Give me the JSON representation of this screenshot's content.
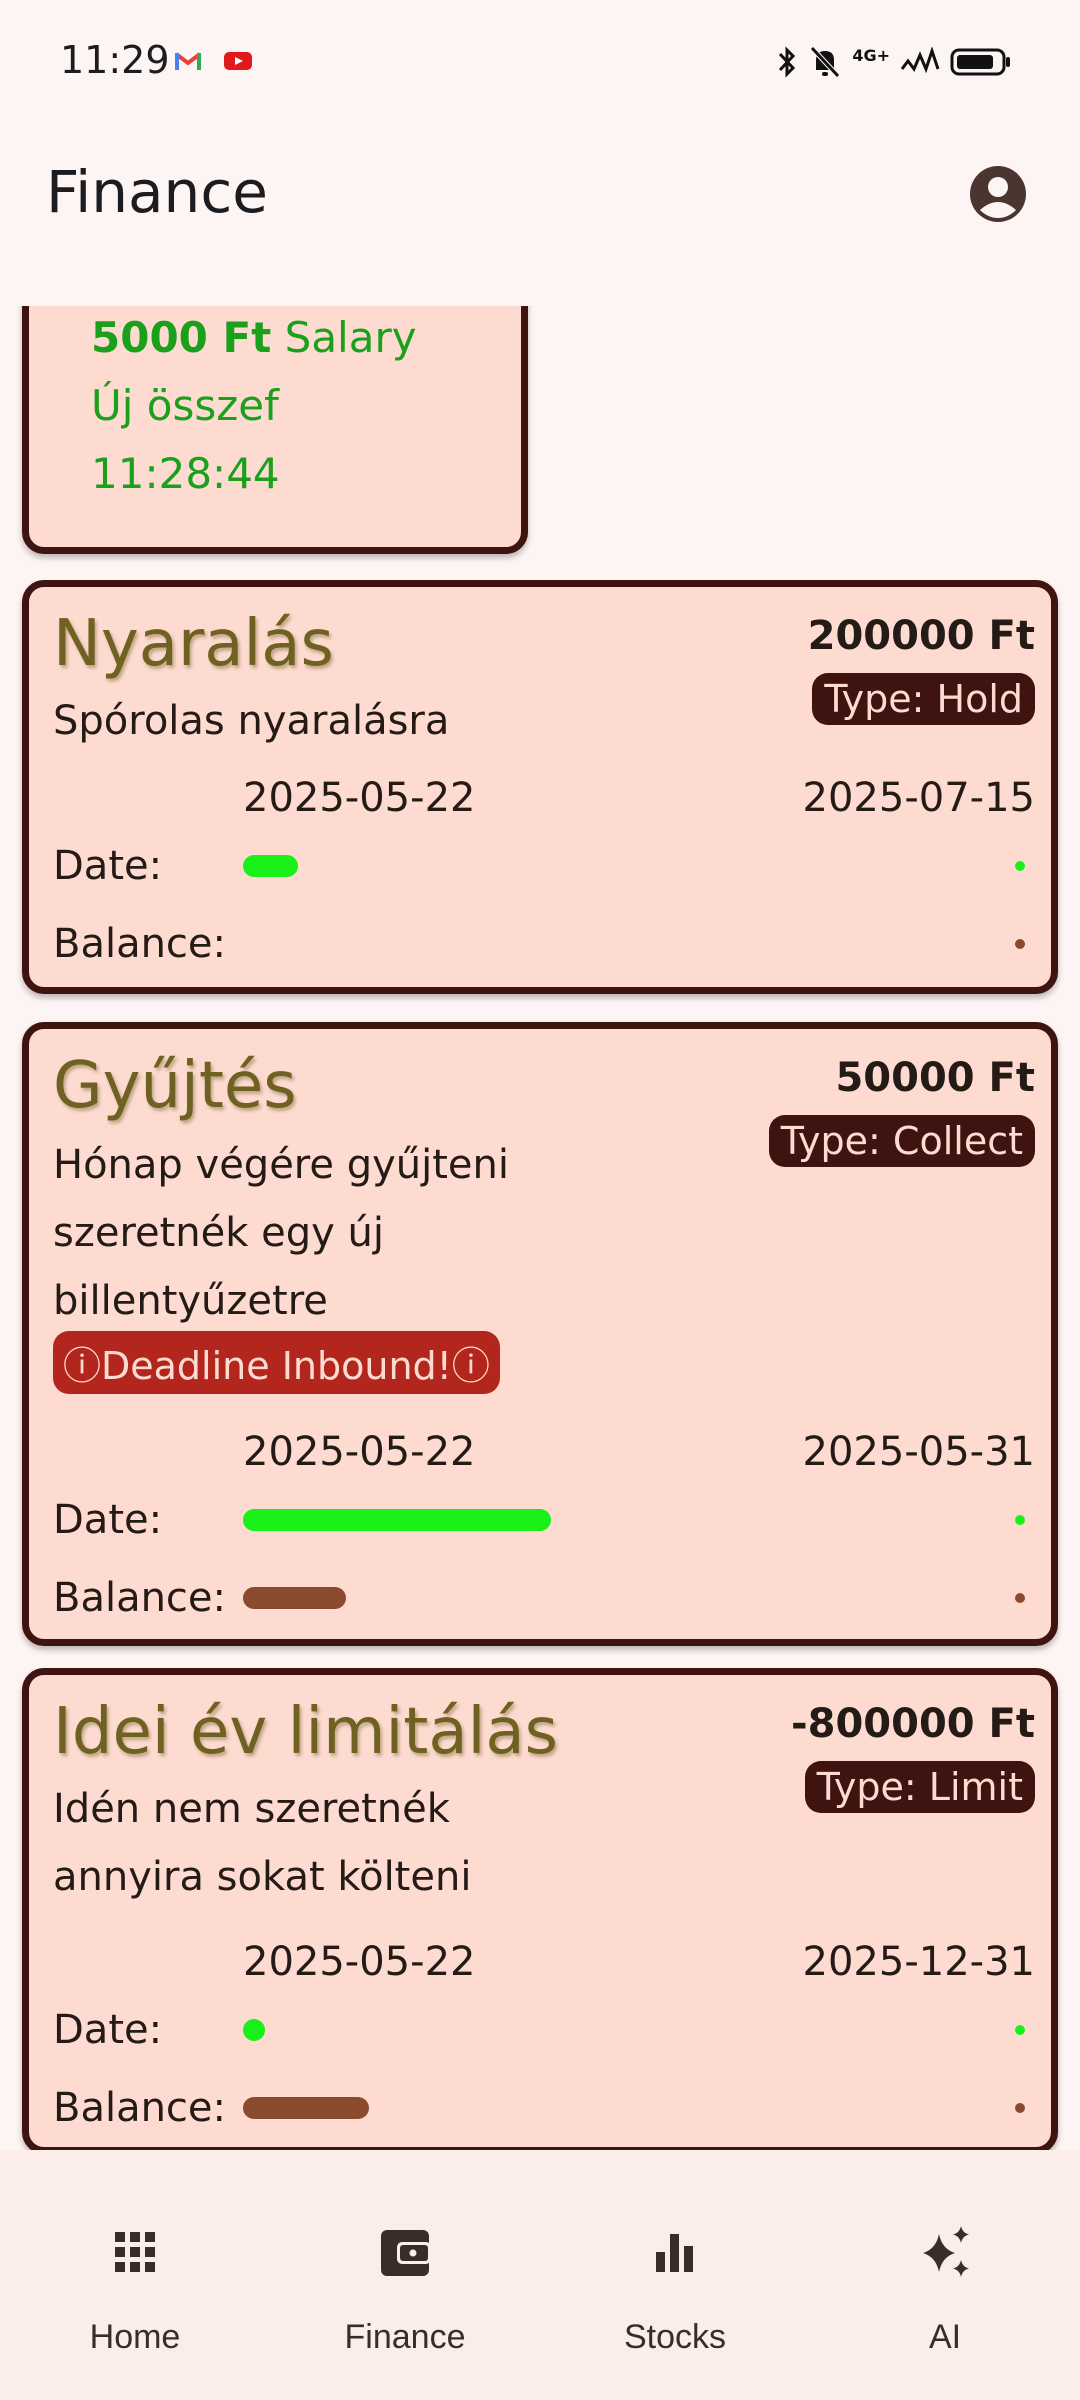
{
  "status": {
    "time": "11:29",
    "network": "4G+"
  },
  "appbar": {
    "title": "Finance"
  },
  "transaction": {
    "amount": "5000 Ft",
    "category": "Salary",
    "note": "Új összef",
    "time": "11:28:44"
  },
  "goals": [
    {
      "title": "Nyaralás",
      "amount": "200000 Ft",
      "type": "Type: Hold",
      "description": "Spórolas nyaralásra",
      "start": "2025-05-22",
      "end": "2025-07-15",
      "date_label": "Date:",
      "balance_label": "Balance:",
      "date_progress": 0.07,
      "balance_progress": 0.0
    },
    {
      "title": "Gyűjtés",
      "amount": "50000 Ft",
      "type": "Type: Collect",
      "description": "Hónap végére gyűjteni szeretnék egy új billentyűzetre",
      "warning": "ⓘDeadline Inbound!ⓘ",
      "start": "2025-05-22",
      "end": "2025-05-31",
      "date_label": "Date:",
      "balance_label": "Balance:",
      "date_progress": 0.39,
      "balance_progress": 0.13
    },
    {
      "title": "Idei év limitálás",
      "amount": "-800000 Ft",
      "type": "Type: Limit",
      "description": "Idén nem szeretnék annyira sokat költeni",
      "start": "2025-05-22",
      "end": "2025-12-31",
      "date_label": "Date:",
      "balance_label": "Balance:",
      "date_progress": 0.02,
      "balance_progress": 0.16
    }
  ],
  "nav": {
    "items": [
      {
        "label": "Home",
        "icon": "grid-icon"
      },
      {
        "label": "Finance",
        "icon": "wallet-icon"
      },
      {
        "label": "Stocks",
        "icon": "bar-chart-icon"
      },
      {
        "label": "AI",
        "icon": "sparkle-icon"
      }
    ]
  },
  "colors": {
    "card_bg": "#fddbd1",
    "card_border": "#3f1410",
    "progress_date": "#18f018",
    "progress_balance": "#8b4a2e",
    "title": "#6e6121",
    "warning": "#b3261e"
  }
}
